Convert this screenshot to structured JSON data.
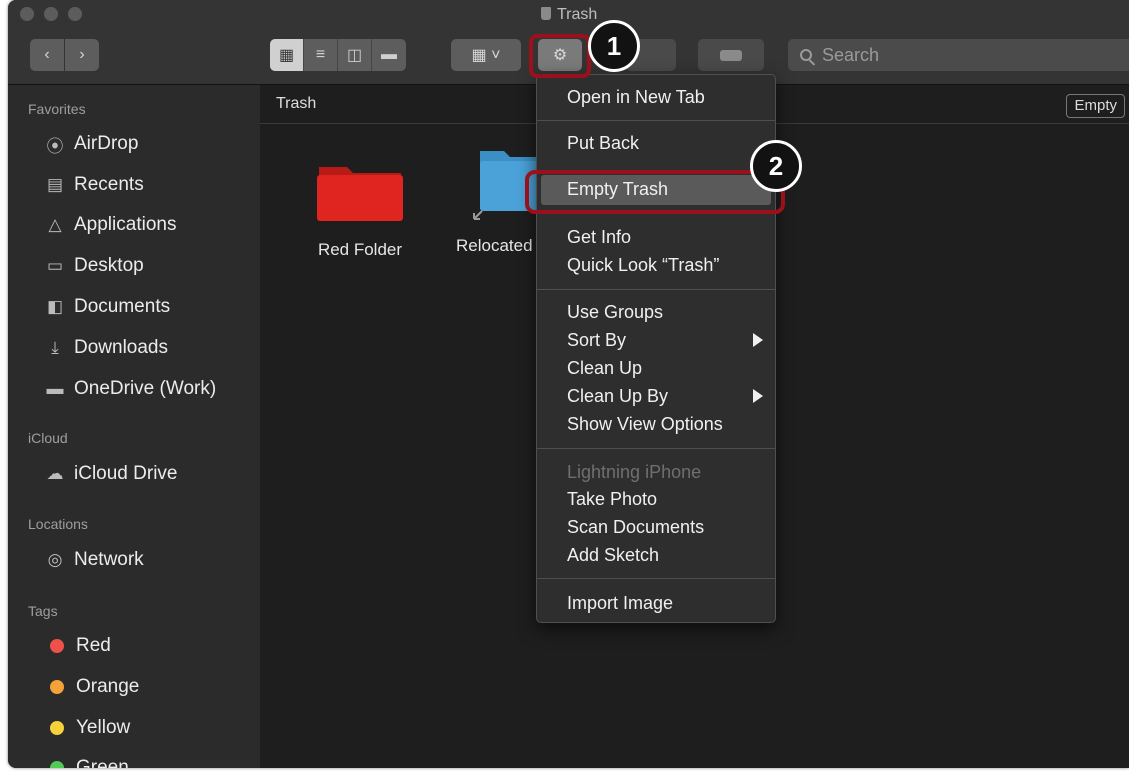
{
  "window": {
    "title": "Trash"
  },
  "toolbar": {
    "back_icon": "chevron-left-icon",
    "forward_icon": "chevron-right-icon",
    "search_placeholder": "Search"
  },
  "sidebar": {
    "sections": [
      {
        "heading": "Favorites",
        "items": [
          {
            "label": "AirDrop",
            "icon": "airdrop-icon"
          },
          {
            "label": "Recents",
            "icon": "recents-icon"
          },
          {
            "label": "Applications",
            "icon": "applications-icon"
          },
          {
            "label": "Desktop",
            "icon": "desktop-icon"
          },
          {
            "label": "Documents",
            "icon": "documents-icon"
          },
          {
            "label": "Downloads",
            "icon": "downloads-icon"
          },
          {
            "label": "OneDrive (Work)",
            "icon": "folder-icon"
          }
        ]
      },
      {
        "heading": "iCloud",
        "items": [
          {
            "label": "iCloud Drive",
            "icon": "cloud-icon"
          }
        ]
      },
      {
        "heading": "Locations",
        "items": [
          {
            "label": "Network",
            "icon": "globe-icon"
          }
        ]
      },
      {
        "heading": "Tags",
        "items": [
          {
            "label": "Red",
            "color": "#f0504a"
          },
          {
            "label": "Orange",
            "color": "#f3a33a"
          },
          {
            "label": "Yellow",
            "color": "#f6d23a"
          },
          {
            "label": "Green",
            "color": "#4fcb56"
          }
        ]
      }
    ]
  },
  "content": {
    "path_title": "Trash",
    "empty_button": "Empty",
    "files": [
      {
        "name": "Red Folder",
        "color": "#e0241f"
      },
      {
        "name": "Relocated",
        "color": "#4aa2d8"
      }
    ]
  },
  "context_menu": {
    "items": [
      {
        "label": "Open in New Tab"
      },
      {
        "label": "Put Back"
      },
      {
        "label": "Empty Trash",
        "highlighted": true
      },
      {
        "label": "Get Info"
      },
      {
        "label": "Quick Look “Trash”"
      },
      {
        "label": "Use Groups"
      },
      {
        "label": "Sort By",
        "submenu": true
      },
      {
        "label": "Clean Up"
      },
      {
        "label": "Clean Up By",
        "submenu": true
      },
      {
        "label": "Show View Options"
      },
      {
        "label": "Lightning iPhone",
        "disabled": true
      },
      {
        "label": "Take Photo"
      },
      {
        "label": "Scan Documents"
      },
      {
        "label": "Add Sketch"
      },
      {
        "label": "Import Image"
      }
    ]
  },
  "annotations": {
    "step1": "1",
    "step2": "2",
    "highlight_color": "#9b111b"
  }
}
